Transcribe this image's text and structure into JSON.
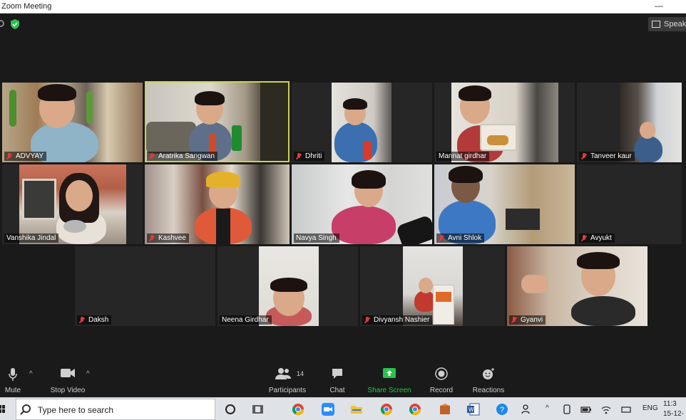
{
  "window": {
    "title": "Zoom Meeting",
    "minimize_glyph": "—"
  },
  "topbar": {
    "speaker_view_label": "Speake"
  },
  "participants": [
    {
      "name": "ADVYAY",
      "muted": true
    },
    {
      "name": "Aratrika Sangwan",
      "muted": true,
      "active_speaker": true
    },
    {
      "name": "Dhriti",
      "muted": true
    },
    {
      "name": "Mannat girdhar",
      "muted": false
    },
    {
      "name": "Tanveer kaur",
      "muted": true
    },
    {
      "name": "Vanshika Jindal",
      "muted": false
    },
    {
      "name": "Kashvee",
      "muted": true
    },
    {
      "name": "Navya Singh",
      "muted": false
    },
    {
      "name": "Avni Shlok",
      "muted": true
    },
    {
      "name": "Avyukt",
      "muted": true
    },
    {
      "name": "Daksh",
      "muted": true
    },
    {
      "name": "Neena Girdhar",
      "muted": false
    },
    {
      "name": "Divyansh Nashier",
      "muted": true
    },
    {
      "name": "Gyanvi",
      "muted": true
    }
  ],
  "toolbar": {
    "mute_label": "Mute",
    "stop_video_label": "Stop Video",
    "participants_label": "Participants",
    "participants_count": "14",
    "chat_label": "Chat",
    "share_screen_label": "Share Screen",
    "record_label": "Record",
    "reactions_label": "Reactions",
    "caret_glyph": "^"
  },
  "taskbar": {
    "search_placeholder": "Type here to search",
    "language": "ENG",
    "time": "11:3",
    "date": "15-12-"
  },
  "colors": {
    "active_speaker_border": "#c9d44a",
    "share_screen_green": "#28c24b",
    "muted_red": "#e23a3a",
    "background": "#1a1a1a"
  },
  "icons": [
    "shield-icon",
    "speaker-view-icon",
    "microphone-icon",
    "video-camera-icon",
    "participants-icon",
    "chat-icon",
    "share-screen-icon",
    "record-icon",
    "reactions-icon",
    "windows-logo-icon",
    "search-icon",
    "task-view-icon"
  ]
}
